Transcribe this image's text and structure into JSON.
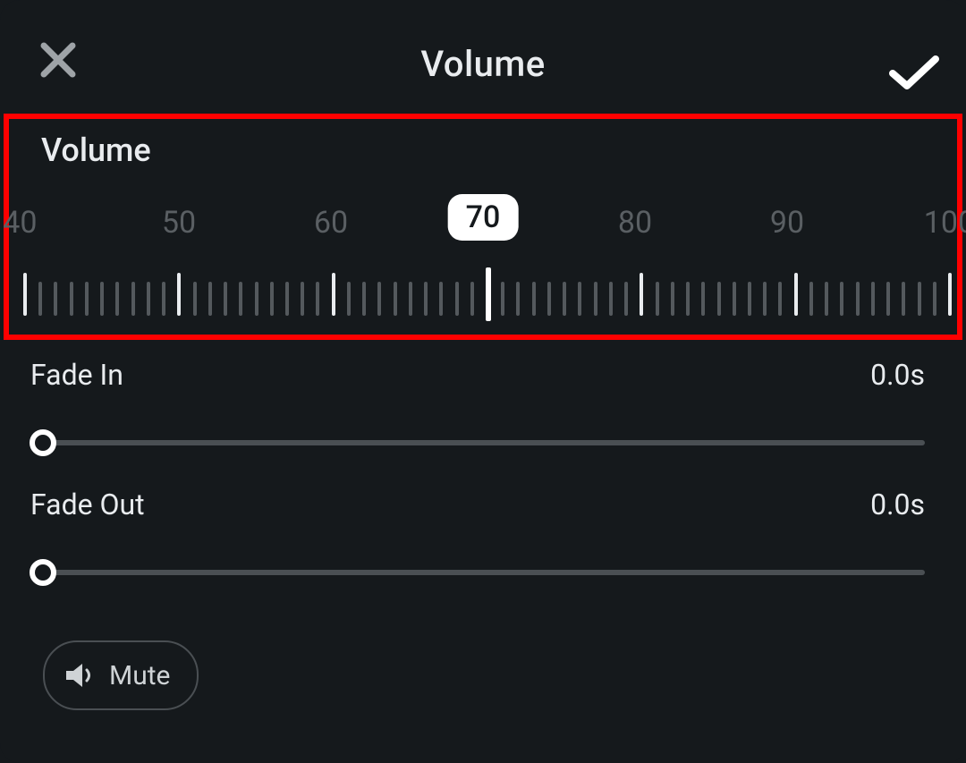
{
  "header": {
    "title": "Volume"
  },
  "volume": {
    "label": "Volume",
    "selected": 70,
    "scale_labels": [
      40,
      50,
      60,
      70,
      80,
      90,
      100
    ]
  },
  "fade_in": {
    "label": "Fade In",
    "value_text": "0.0s",
    "value": 0
  },
  "fade_out": {
    "label": "Fade Out",
    "value_text": "0.0s",
    "value": 0
  },
  "mute": {
    "label": "Mute"
  }
}
